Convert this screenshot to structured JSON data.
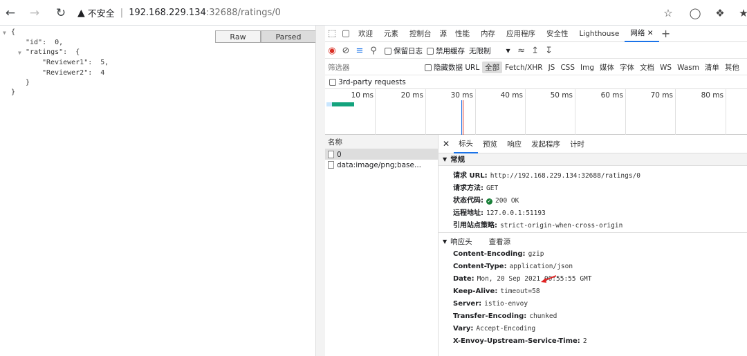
{
  "address_bar": {
    "security_label": "不安全",
    "url_host": "192.168.229.134",
    "url_path": ":32688/ratings/0"
  },
  "json_view": {
    "raw_label": "Raw",
    "parsed_label": "Parsed",
    "lines": [
      "{",
      "\"id\":  0,",
      "\"ratings\":  {",
      "\"Reviewer1\":  5,",
      "\"Reviewer2\":  4",
      "}",
      "}"
    ]
  },
  "devtools": {
    "tabs": [
      "欢迎",
      "元素",
      "控制台",
      "源",
      "性能",
      "内存",
      "应用程序",
      "安全性",
      "Lighthouse",
      "网络"
    ],
    "preserve_log": "保留日志",
    "disable_cache": "禁用缓存",
    "throttling": "无限制",
    "filter_placeholder": "筛选器",
    "hide_data_urls": "隐藏数据 URL",
    "filter_types": [
      "全部",
      "Fetch/XHR",
      "JS",
      "CSS",
      "Img",
      "媒体",
      "字体",
      "文档",
      "WS",
      "Wasm",
      "清单",
      "其他"
    ],
    "third_party": "3rd-party requests",
    "timeline_ticks": [
      "10 ms",
      "20 ms",
      "30 ms",
      "40 ms",
      "50 ms",
      "60 ms",
      "70 ms",
      "80 ms"
    ],
    "list_header": "名称",
    "requests": [
      "0",
      "data:image/png;base..."
    ],
    "detail_tabs": [
      "标头",
      "预览",
      "响应",
      "发起程序",
      "计时"
    ],
    "general": {
      "title": "常规",
      "request_url_k": "请求 URL:",
      "request_url_v": "http://192.168.229.134:32688/ratings/0",
      "method_k": "请求方法:",
      "method_v": "GET",
      "status_k": "状态代码:",
      "status_v": "200 OK",
      "remote_k": "远程地址:",
      "remote_v": "127.0.0.1:51193",
      "referrer_k": "引用站点策略:",
      "referrer_v": "strict-origin-when-cross-origin"
    },
    "response_headers": {
      "title": "响应头",
      "view_source": "查看源",
      "items": [
        {
          "k": "Content-Encoding:",
          "v": "gzip"
        },
        {
          "k": "Content-Type:",
          "v": "application/json"
        },
        {
          "k": "Date:",
          "v": "Mon, 20 Sep 2021 00:55:55 GMT"
        },
        {
          "k": "Keep-Alive:",
          "v": "timeout=58"
        },
        {
          "k": "Server:",
          "v": "istio-envoy"
        },
        {
          "k": "Transfer-Encoding:",
          "v": "chunked"
        },
        {
          "k": "Vary:",
          "v": "Accept-Encoding"
        },
        {
          "k": "X-Envoy-Upstream-Service-Time:",
          "v": "2"
        }
      ]
    }
  }
}
